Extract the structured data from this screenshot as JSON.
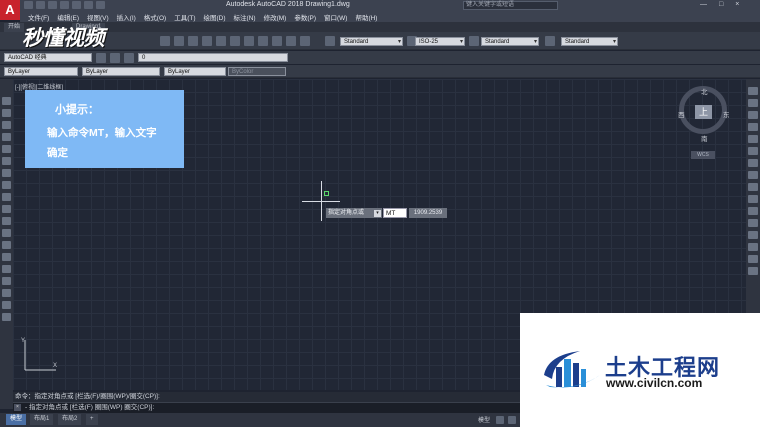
{
  "titlebar": {
    "app_logo": "A",
    "title": "Autodesk AutoCAD 2018    Drawing1.dwg",
    "search_placeholder": "键入关键字或短语",
    "window_controls": [
      "—",
      "□",
      "×"
    ]
  },
  "menubar": {
    "items": [
      "文件(F)",
      "编辑(E)",
      "视图(V)",
      "插入(I)",
      "格式(O)",
      "工具(T)",
      "绘图(D)",
      "标注(N)",
      "修改(M)",
      "参数(P)",
      "窗口(W)",
      "帮助(H)"
    ]
  },
  "file_tabs": {
    "start": "开始",
    "drawing": "Drawing1"
  },
  "watermark": "秒懂视频",
  "toolbar": {
    "workspace": "AutoCAD 经典",
    "text_style": "Standard",
    "dim_style": "ISO-25",
    "table_style": "Standard",
    "multileader_style": "Standard",
    "layer": "0"
  },
  "properties": {
    "color": "ByLayer",
    "linetype": "ByLayer",
    "lineweight": "ByLayer",
    "plot_style": "ByColor"
  },
  "viewport": {
    "label": "[-][俯视][二维线框]"
  },
  "tip": {
    "title": "小提示：",
    "line1": "输入命令MT，输入文字",
    "line2": "确定"
  },
  "viewcube": {
    "face": "上",
    "north": "北",
    "south": "南",
    "west": "西",
    "east": "东",
    "wcs": "WCS"
  },
  "dynamic_input": {
    "prompt": "指定对角点或",
    "arrow": "▾",
    "value": "MT",
    "coordinate": "1909.2539"
  },
  "command": {
    "history": "命令：指定对角点或 [栏选(F)/圈围(WP)/圈交(CP)]:",
    "current": "- 指定对角点或 [栏选(F) 圈围(WP) 圈交(CP)]:",
    "close": "×"
  },
  "status": {
    "model_tab": "模型",
    "layout1": "布局1",
    "layout2": "布局2",
    "add": "+",
    "model_label": "模型"
  },
  "site_logo": {
    "name": "土木工程网",
    "url": "www.civilcn.com"
  },
  "colors": {
    "canvas_bg": "#212735",
    "tip_bg": "#7fb9f5",
    "accent_red": "#c8232c",
    "logo_blue": "#1c3e8c"
  }
}
